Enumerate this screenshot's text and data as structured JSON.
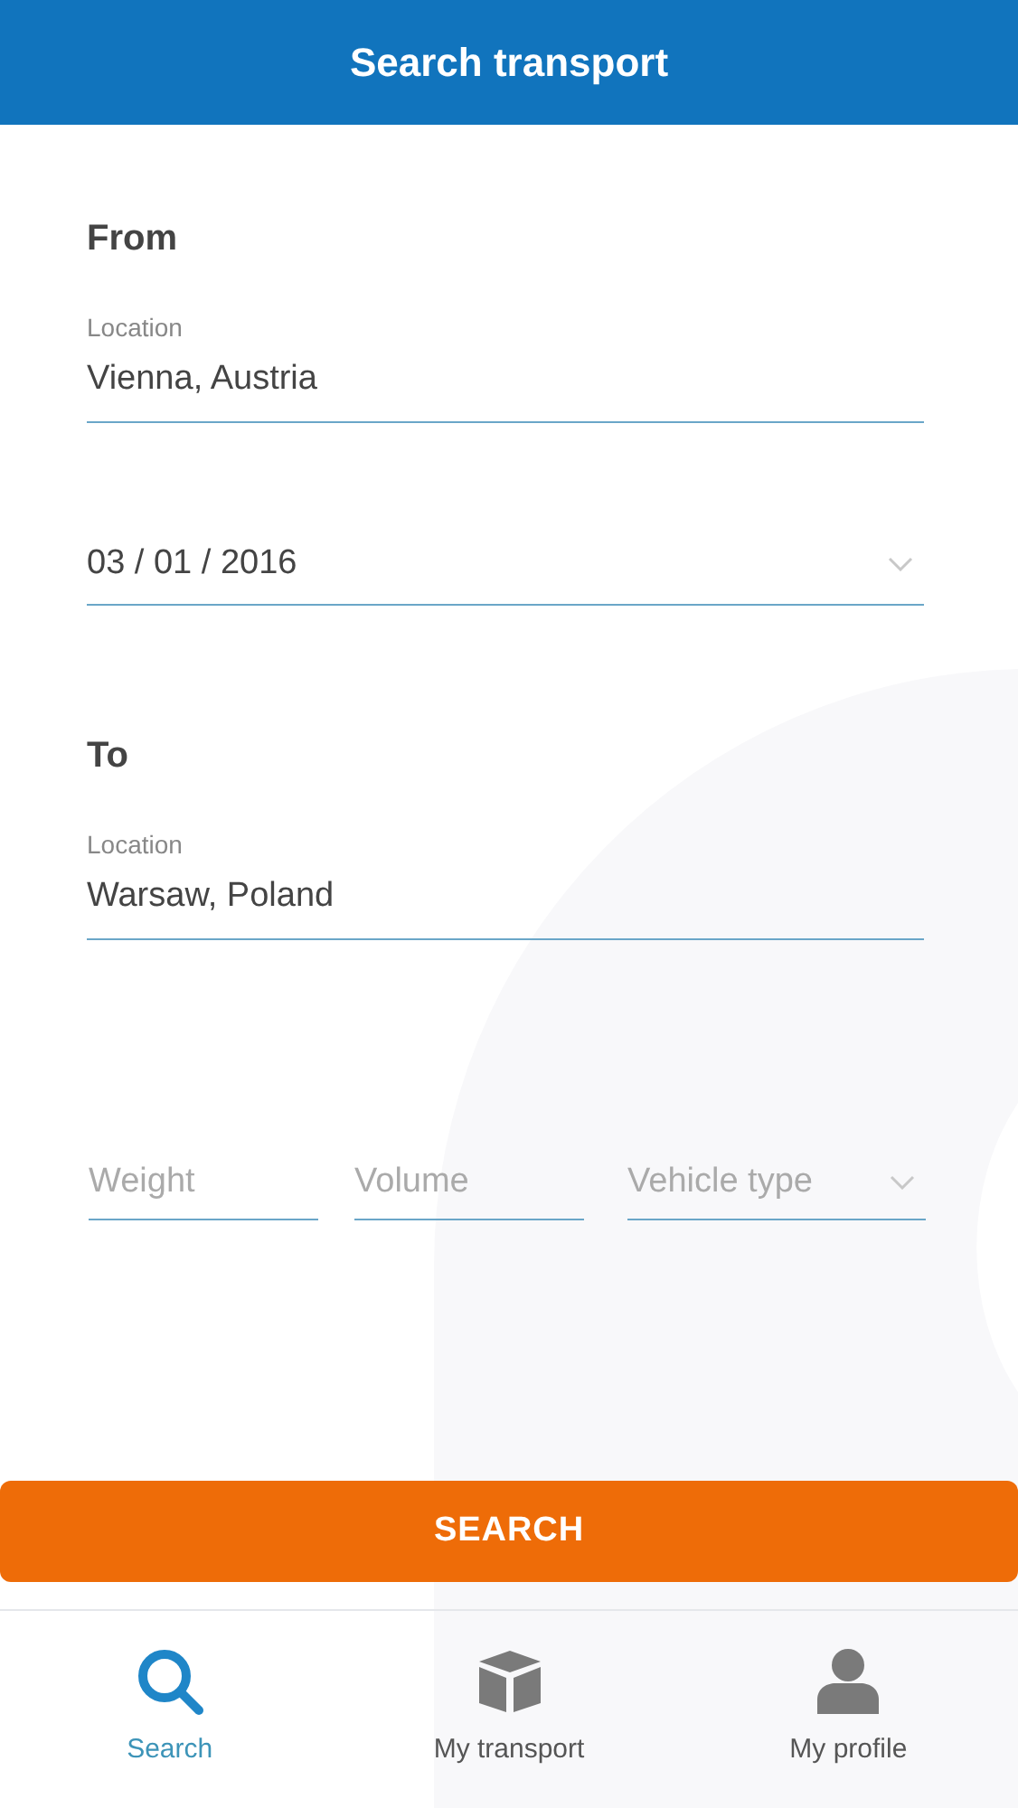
{
  "header": {
    "title": "Search transport"
  },
  "sections": [
    {
      "heading": "From",
      "fields": [
        {
          "kind": "text",
          "label": "Location",
          "value": "Vienna, Austria"
        },
        {
          "kind": "select",
          "value": "03 / 01 / 2016"
        }
      ]
    },
    {
      "heading": "To",
      "fields": [
        {
          "kind": "text",
          "label": "Location",
          "value": "Warsaw, Poland"
        }
      ]
    }
  ],
  "cargo_fields": [
    {
      "kind": "text",
      "placeholder": "Weight"
    },
    {
      "kind": "text",
      "placeholder": "Volume"
    },
    {
      "kind": "select",
      "placeholder": "Vehicle type"
    }
  ],
  "search_button": "SEARCH",
  "tabs": [
    {
      "kind": "search",
      "label": "Search",
      "selected": true
    },
    {
      "kind": "box",
      "label": "My transport",
      "selected": false
    },
    {
      "kind": "person",
      "label": "My profile",
      "selected": false
    }
  ]
}
